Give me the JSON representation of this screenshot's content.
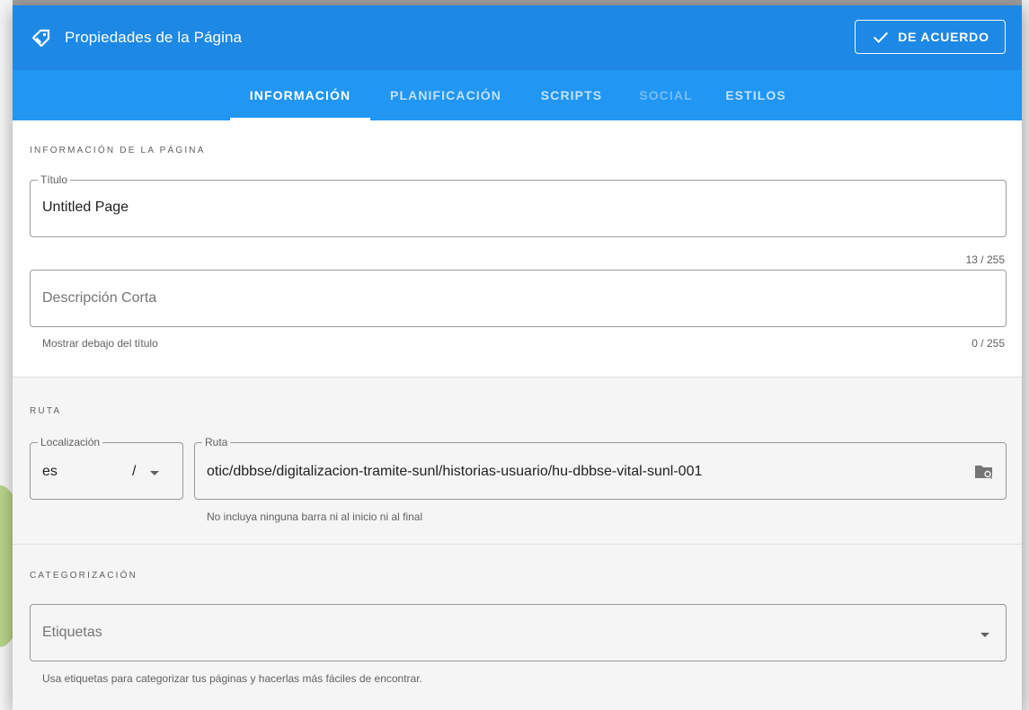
{
  "dialog": {
    "title": "Propiedades de la Página",
    "ok_label": "DE ACUERDO"
  },
  "tabs": [
    {
      "label": "INFORMACIÓN",
      "state": "active"
    },
    {
      "label": "PLANIFICACIÓN",
      "state": "normal"
    },
    {
      "label": "SCRIPTS",
      "state": "normal"
    },
    {
      "label": "SOCIAL",
      "state": "disabled"
    },
    {
      "label": "ESTILOS",
      "state": "normal"
    }
  ],
  "info": {
    "section_label": "INFORMACIÓN DE LA PÁGINA",
    "title_field": {
      "label": "Título",
      "value": "Untitled Page",
      "counter": "13 / 255"
    },
    "description_field": {
      "placeholder": "Descripción Corta",
      "hint": "Mostrar debajo del título",
      "counter": "0 / 255"
    }
  },
  "path": {
    "section_label": "RUTA",
    "locale": {
      "label": "Localización",
      "value": "es",
      "separator": "/"
    },
    "route": {
      "label": "Ruta",
      "value": "otic/dbbse/digitalizacion-tramite-sunl/historias-usuario/hu-dbbse-vital-sunl-001",
      "hint": "No incluya ninguna barra ni al inicio ni al final"
    }
  },
  "categorization": {
    "section_label": "CATEGORIZACIÓN",
    "tags": {
      "placeholder": "Etiquetas",
      "hint": "Usa etiquetas para categorizar tus páginas y hacerlas más fáciles de encontrar."
    }
  },
  "colors": {
    "toolbar": "#1e88e5",
    "tabs": "#2196f3",
    "section_bg": "#f5f5f5"
  },
  "icons": {
    "header": "tag-icon",
    "ok": "check-icon",
    "browse": "folder-search-icon",
    "dropdown": "caret-down-icon"
  }
}
